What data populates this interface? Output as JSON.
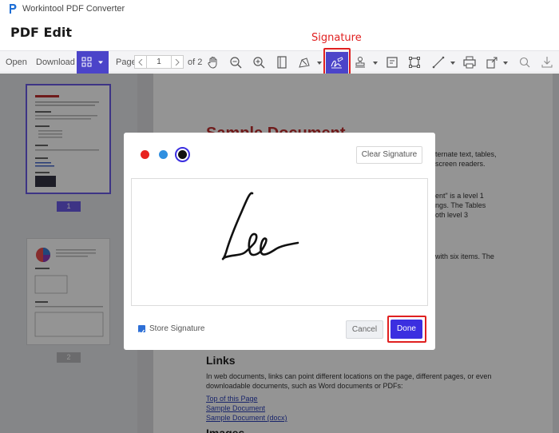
{
  "app": {
    "title": "Workintool PDF Converter",
    "page_heading": "PDF Edit"
  },
  "annotations": {
    "signature_label": "Signature"
  },
  "toolbar": {
    "open_label": "Open",
    "download_label": "Download",
    "page_label": "Page",
    "current_page": "1",
    "page_total": "of 2",
    "accent_color": "#4b44c9"
  },
  "sidebar": {
    "pages": [
      {
        "label": "1"
      },
      {
        "label": "2"
      }
    ]
  },
  "document": {
    "title_partial": "Sample Document",
    "frag_lines": [
      "ternate text, tables,",
      "screen readers.",
      "ent\" is a level 1",
      "ngs. The Tables",
      "oth level 3",
      "with six items. The"
    ],
    "links_heading": "Links",
    "links_paragraph": [
      "In web documents, links can point different locations on the page, different pages, or even",
      "downloadable documents, such as Word documents or PDFs:"
    ],
    "links": [
      "Top of this Page",
      "Sample Document",
      "Sample Document (docx)"
    ],
    "images_heading": "Images"
  },
  "signature_dialog": {
    "colors": [
      "#e8231f",
      "#2f8fe0",
      "#111111"
    ],
    "selected_color": "#111111",
    "clear_label": "Clear Signature",
    "store_label": "Store Signature",
    "store_checked": true,
    "cancel_label": "Cancel",
    "done_label": "Done",
    "done_color": "#3b2fe0"
  }
}
